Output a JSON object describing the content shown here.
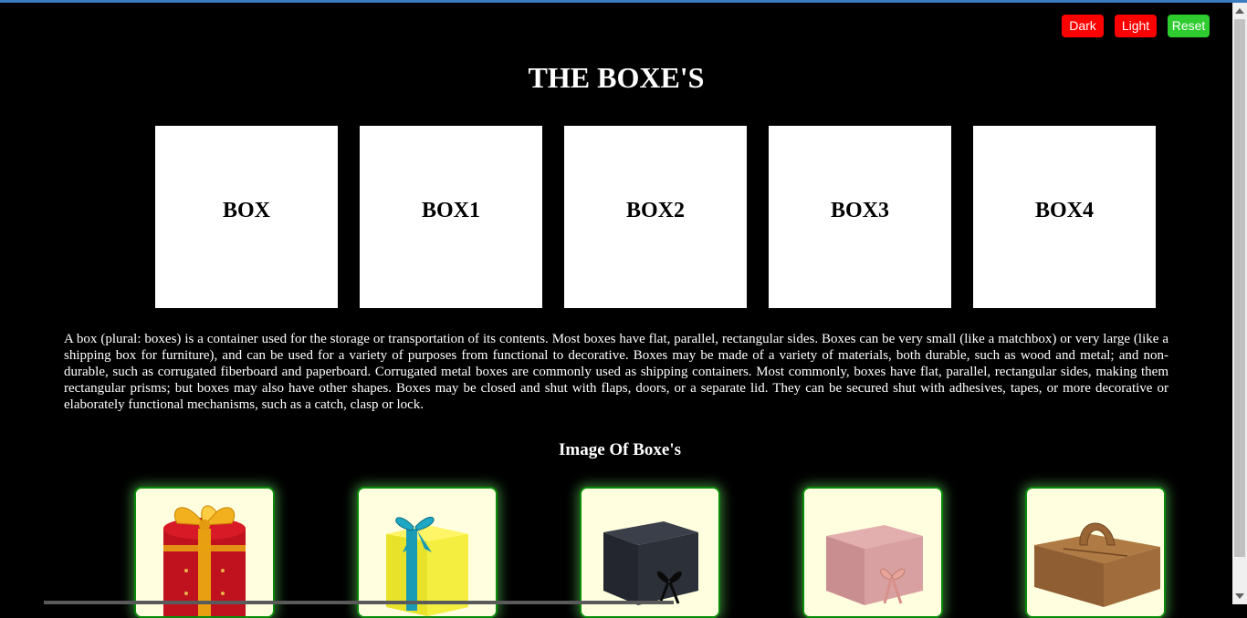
{
  "controls": {
    "dark_label": "Dark",
    "light_label": "Light",
    "reset_label": "Reset",
    "dark_color": "#ff0000",
    "light_color": "#ff0000",
    "reset_color": "#2ecc2e"
  },
  "page_title": "THE BOXE'S",
  "boxes": [
    "BOX",
    "BOX1",
    "BOX2",
    "BOX3",
    "BOX4"
  ],
  "description": "A box (plural: boxes) is a container used for the storage or transportation of its contents. Most boxes have flat, parallel, rectangular sides. Boxes can be very small (like a matchbox) or very large (like a shipping box for furniture), and can be used for a variety of purposes from functional to decorative. Boxes may be made of a variety of materials, both durable, such as wood and metal; and non-durable, such as corrugated fiberboard and paperboard. Corrugated metal boxes are commonly used as shipping containers. Most commonly, boxes have flat, parallel, rectangular sides, making them rectangular prisms; but boxes may also have other shapes. Boxes may be closed and shut with flaps, doors, or a separate lid. They can be secured shut with adhesives, tapes, or more decorative or elaborately functional mechanisms, such as a catch, clasp or lock.",
  "gallery_title": "Image Of Boxe's",
  "gallery": [
    {
      "image": "red-cylinder-gift-box-with-gold-ribbon"
    },
    {
      "image": "yellow-hexagon-gift-box-with-blue-ribbon"
    },
    {
      "image": "black-gift-box-with-black-bow"
    },
    {
      "image": "pink-gift-box-with-pink-bow"
    },
    {
      "image": "brown-kraft-box-with-handle"
    }
  ],
  "colors": {
    "page_background": "#000000",
    "card_background": "#ffffe0",
    "card_border": "#0a8a0a"
  }
}
